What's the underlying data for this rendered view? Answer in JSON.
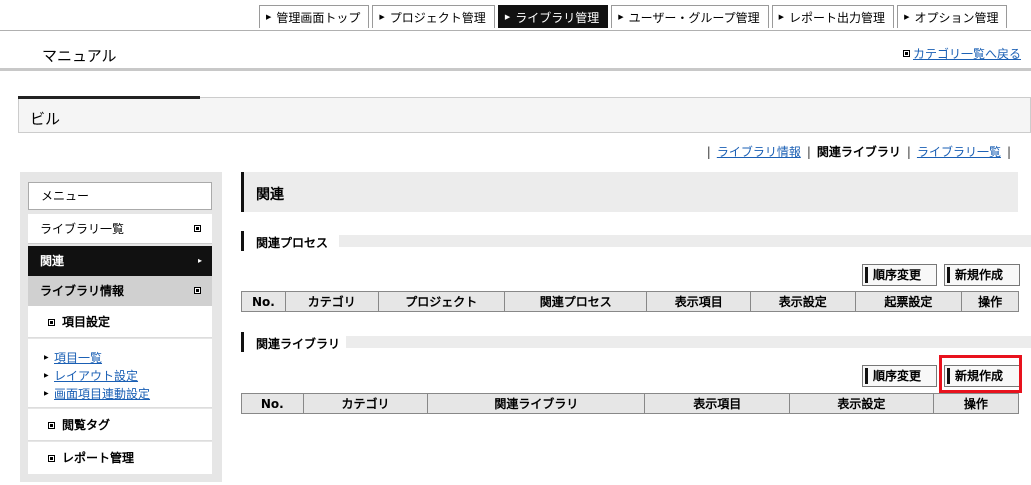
{
  "nav": {
    "tabs": [
      {
        "label": "管理画面トップ",
        "active": false
      },
      {
        "label": "プロジェクト管理",
        "active": false
      },
      {
        "label": "ライブラリ管理",
        "active": true
      },
      {
        "label": "ユーザー・グループ管理",
        "active": false
      },
      {
        "label": "レポート出力管理",
        "active": false
      },
      {
        "label": "オプション管理",
        "active": false
      }
    ]
  },
  "header": {
    "title": "マニュアル",
    "back_link": "カテゴリ一覧へ戻る"
  },
  "section": {
    "title": "ビル"
  },
  "subnav": {
    "library_info": "ライブラリ情報",
    "related_library": "関連ライブラリ",
    "library_list": "ライブラリ一覧",
    "sep": "|"
  },
  "sidebar": {
    "menu_label": "メニュー",
    "library_list": "ライブラリ一覧",
    "related": "関連",
    "library_info": "ライブラリ情報",
    "item_settings": "項目設定",
    "item_links": [
      "項目一覧",
      "レイアウト設定",
      "画面項目連動設定"
    ],
    "view_tag": "閲覧タグ",
    "report_mgmt": "レポート管理"
  },
  "main": {
    "title": "関連",
    "process_section": {
      "title": "関連プロセス",
      "reorder_button": "順序変更",
      "create_button": "新規作成",
      "columns": [
        "No.",
        "カテゴリ",
        "プロジェクト",
        "関連プロセス",
        "表示項目",
        "表示設定",
        "起票設定",
        "操作"
      ]
    },
    "library_section": {
      "title": "関連ライブラリ",
      "reorder_button": "順序変更",
      "create_button": "新規作成",
      "columns": [
        "No.",
        "カテゴリ",
        "関連ライブラリ",
        "表示項目",
        "表示設定",
        "操作"
      ]
    }
  },
  "colors": {
    "highlight": "#e8121d",
    "active_tab": "#111111",
    "link": "#1a5fb4"
  }
}
